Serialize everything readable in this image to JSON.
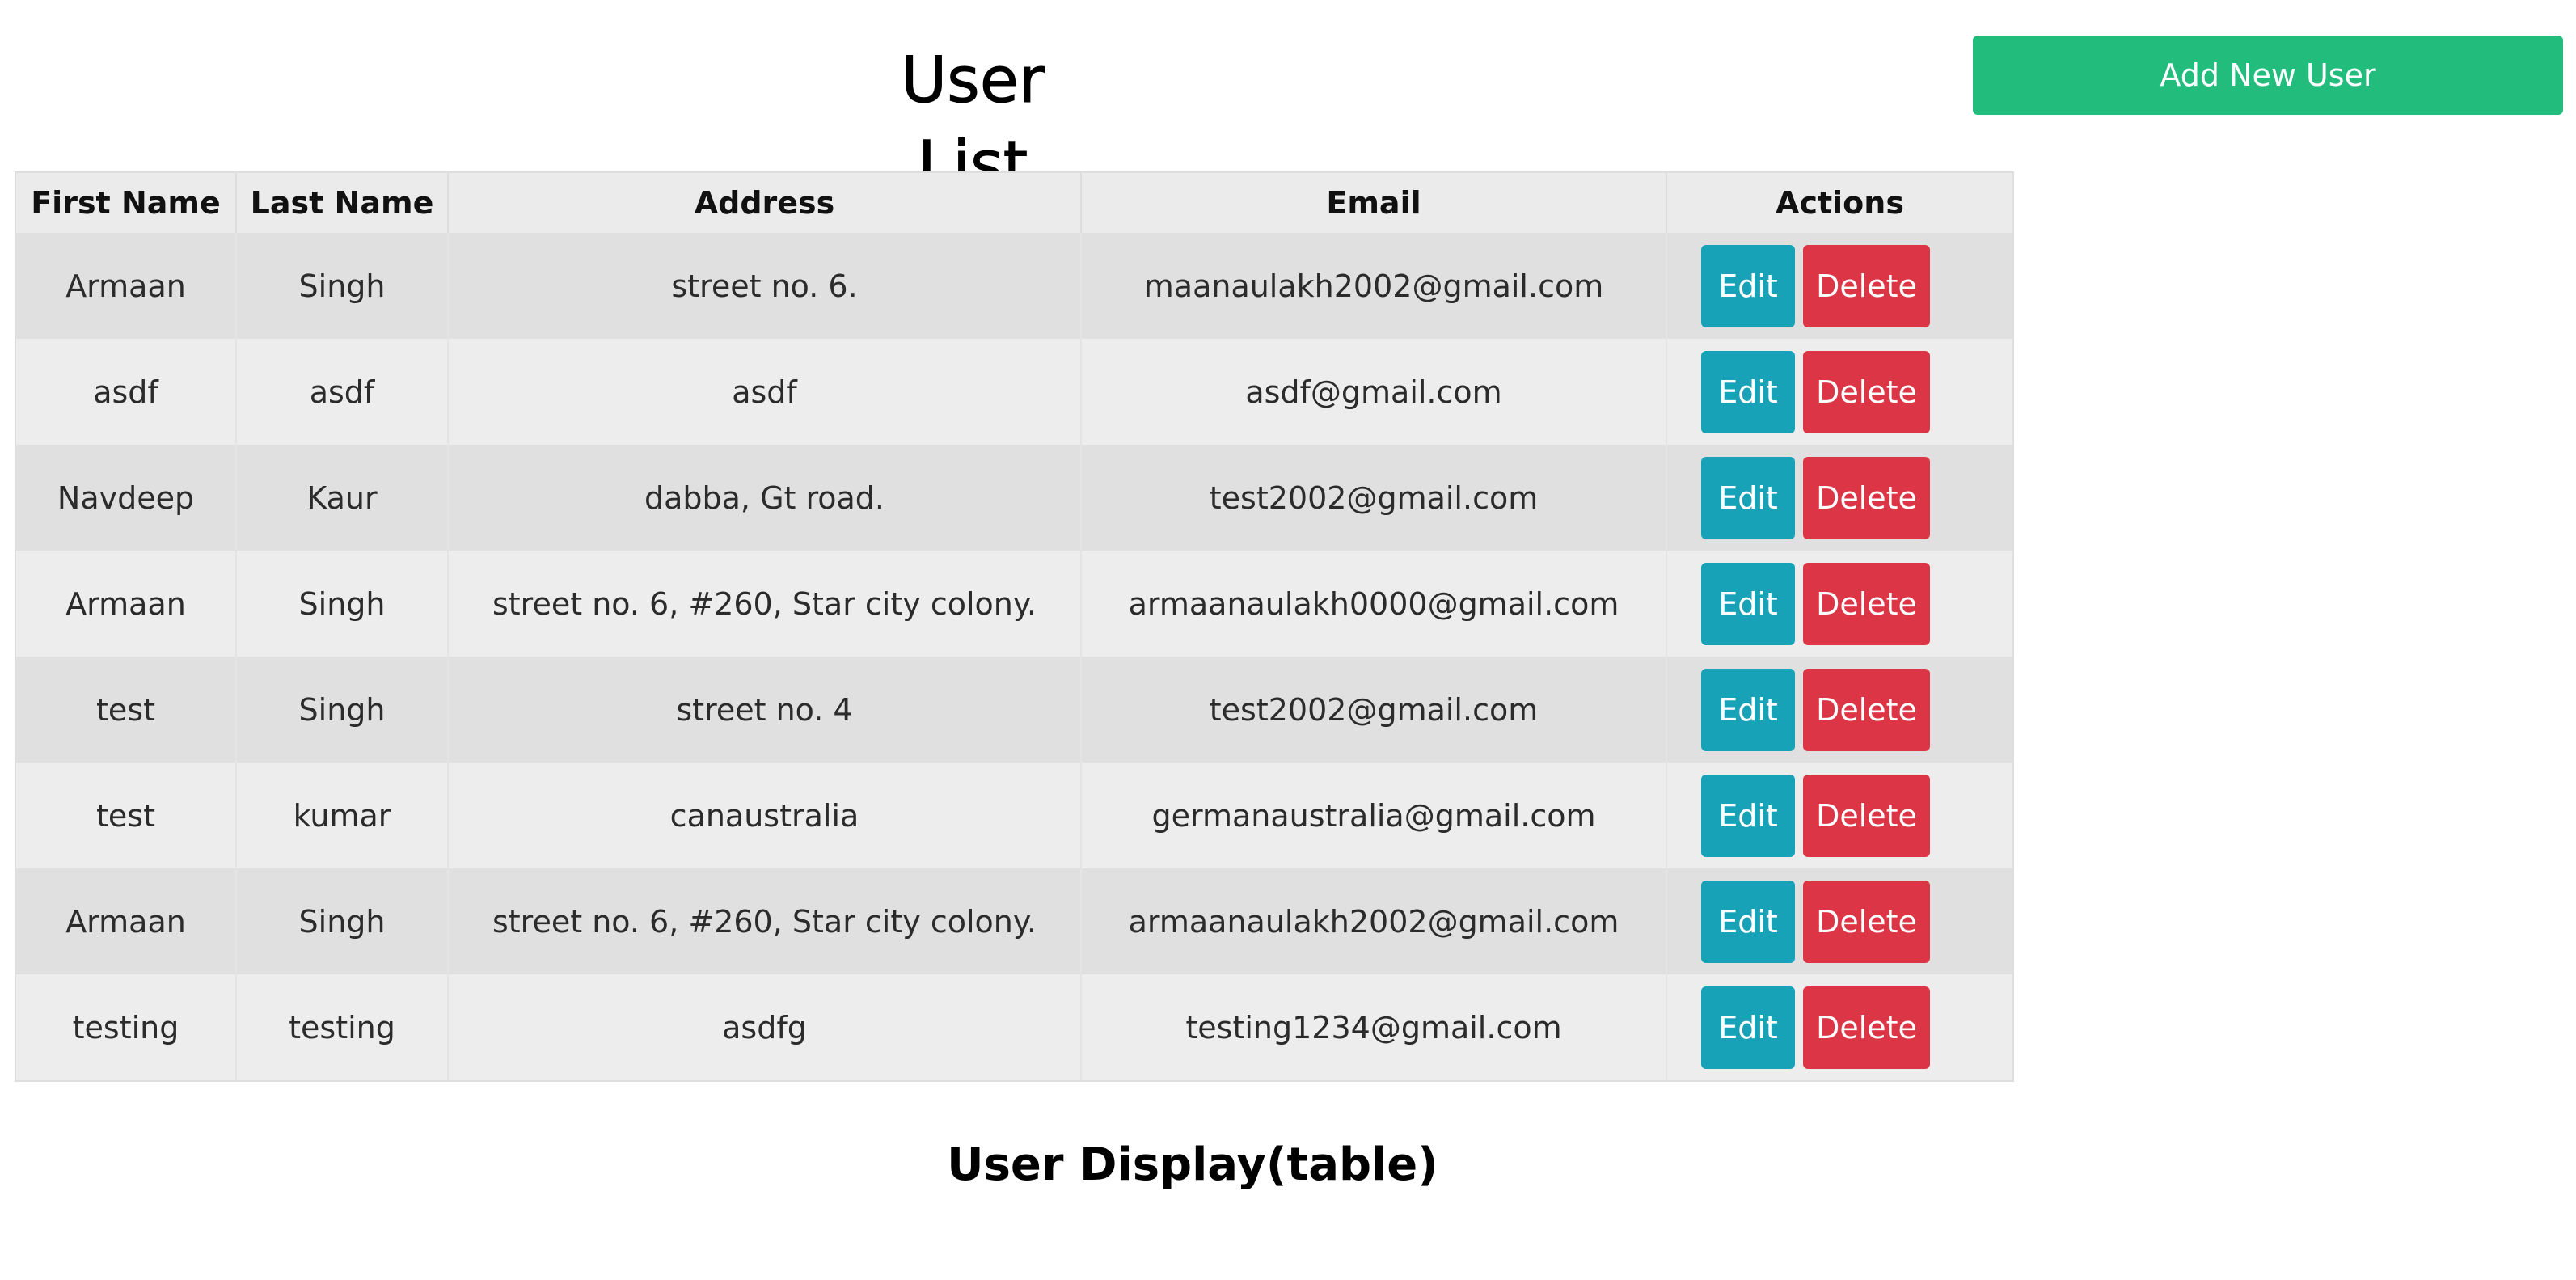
{
  "header": {
    "title": "User List",
    "add_button_label": "Add New User"
  },
  "table": {
    "columns": [
      "First Name",
      "Last Name",
      "Address",
      "Email",
      "Actions"
    ],
    "rows": [
      {
        "first_name": "Armaan",
        "last_name": "Singh",
        "address": "street no. 6.",
        "email": "maanaulakh2002@gmail.com"
      },
      {
        "first_name": "asdf",
        "last_name": "asdf",
        "address": "asdf",
        "email": "asdf@gmail.com"
      },
      {
        "first_name": "Navdeep",
        "last_name": "Kaur",
        "address": "dabba, Gt road.",
        "email": "test2002@gmail.com"
      },
      {
        "first_name": "Armaan",
        "last_name": "Singh",
        "address": "street no. 6, #260, Star city colony.",
        "email": "armaanaulakh0000@gmail.com"
      },
      {
        "first_name": "test",
        "last_name": "Singh",
        "address": "street no. 4",
        "email": "test2002@gmail.com"
      },
      {
        "first_name": "test",
        "last_name": "kumar",
        "address": "canaustralia",
        "email": "germanaustralia@gmail.com"
      },
      {
        "first_name": "Armaan",
        "last_name": "Singh",
        "address": "street no. 6, #260, Star city colony.",
        "email": "armaanaulakh2002@gmail.com"
      },
      {
        "first_name": "testing",
        "last_name": "testing",
        "address": "asdfg",
        "email": "testing1234@gmail.com"
      }
    ],
    "edit_label": "Edit",
    "delete_label": "Delete"
  },
  "caption": "User Display(table)",
  "colors": {
    "add_button": "#22bd7d",
    "edit_button": "#17a2b8",
    "delete_button": "#dc3545"
  }
}
